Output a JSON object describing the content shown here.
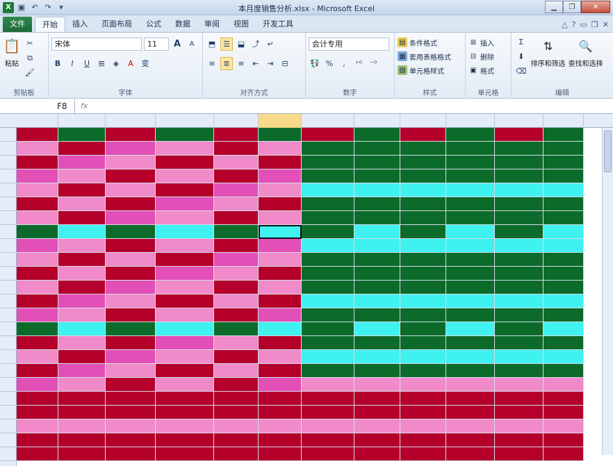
{
  "window": {
    "title": "本月度销售分析.xlsx - Microsoft Excel",
    "app_icon": "X"
  },
  "tabs": [
    {
      "label": "文件"
    },
    {
      "label": "开始"
    },
    {
      "label": "插入"
    },
    {
      "label": "页面布局"
    },
    {
      "label": "公式"
    },
    {
      "label": "数据"
    },
    {
      "label": "审阅"
    },
    {
      "label": "视图"
    },
    {
      "label": "开发工具"
    }
  ],
  "ribbon": {
    "clipboard": {
      "paste": "粘贴",
      "label": "剪贴板"
    },
    "font": {
      "name": "宋体",
      "size": "11",
      "bold": "B",
      "italic": "I",
      "underline": "U",
      "grow": "A",
      "shrink": "A",
      "font_color": "A",
      "wen": "变",
      "label": "字体"
    },
    "alignment": {
      "label": "对齐方式"
    },
    "number": {
      "format": "会计专用",
      "percent": "%",
      "comma": ",",
      "label": "数字"
    },
    "styles": {
      "conditional": "条件格式",
      "table": "套用表格格式",
      "cell": "单元格样式",
      "label": "样式"
    },
    "cells": {
      "insert": "插入",
      "delete": "删除",
      "format": "格式",
      "label": "单元格"
    },
    "editing": {
      "sort": "排序和筛选",
      "find": "查找和选择",
      "label": "编辑"
    }
  },
  "formula_bar": {
    "cell_ref": "F8",
    "fx": "fx"
  },
  "colors": {
    "red": "#b4002a",
    "pink": "#f08ac8",
    "green": "#0c6b2a",
    "cyan": "#3ff2f0",
    "header": "#e4ecf7"
  }
}
